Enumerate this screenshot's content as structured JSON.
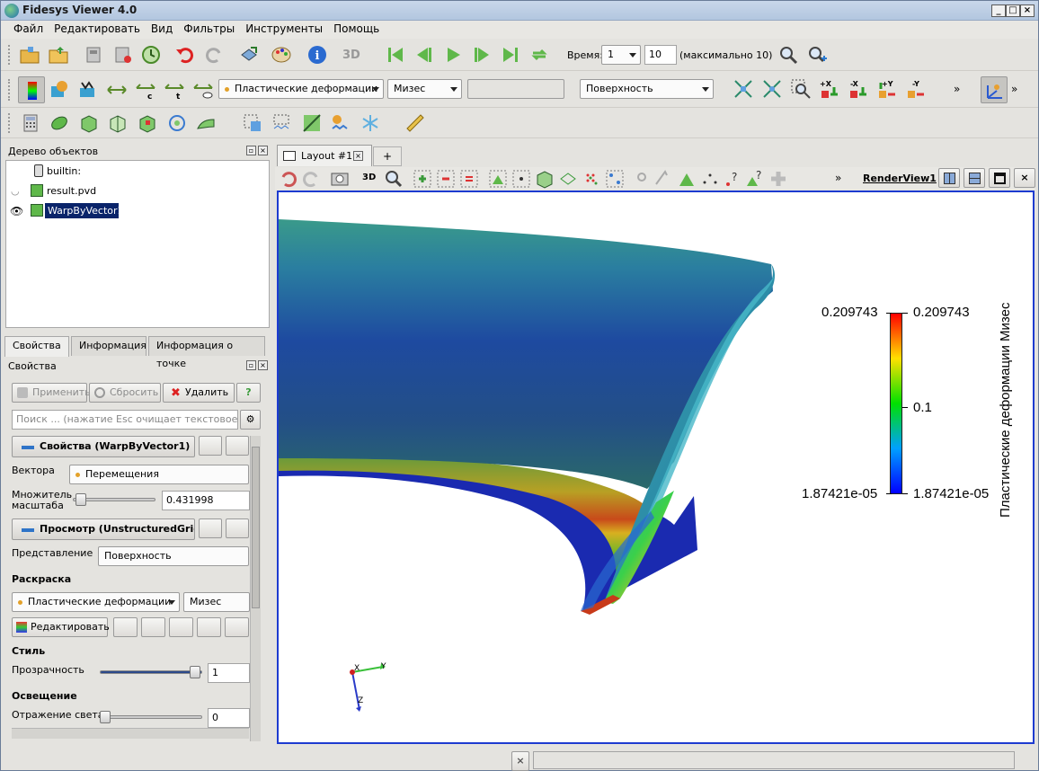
{
  "window": {
    "title": "Fidesys Viewer 4.0"
  },
  "menu": [
    "Файл",
    "Редактировать",
    "Вид",
    "Фильтры",
    "Инструменты",
    "Помощь"
  ],
  "time": {
    "label": "Время:",
    "value": "1",
    "step": "10",
    "max_text": "(максимально 10)"
  },
  "toolbar2": {
    "field": "Пластические деформации",
    "component": "Мизес",
    "representation": "Поверхность"
  },
  "pipeline": {
    "title": "Дерево объектов",
    "items": [
      "builtin:",
      "result.pvd",
      "WarpByVector1"
    ]
  },
  "tabs": {
    "layout": "Layout #1",
    "add": "+",
    "view_name": "RenderView1",
    "props": "Свойства",
    "info": "Информация",
    "point_info": "Информация о точке"
  },
  "props": {
    "title": "Свойства",
    "apply": "Применить",
    "reset": "Сбросить",
    "delete": "Удалить",
    "help": "?",
    "search_placeholder": "Поиск ... (нажатие Esc очищает текстовое по...",
    "section1": "Свойства (WarpByVector1)",
    "vectors_label": "Вектора",
    "vectors_value": "Перемещения",
    "scale_label": "Множитель масштаба",
    "scale_value": "0.431998",
    "scale_level": 0.06,
    "section2": "Просмотр (UnstructuredGrid",
    "repr_label": "Представление",
    "repr_value": "Поверхность",
    "coloring": "Раскраска",
    "color_field": "Пластические деформации",
    "color_comp": "Мизес",
    "edit": "Редактировать",
    "style": "Стиль",
    "opacity_label": "Прозрачность",
    "opacity_value": "1",
    "opacity_level": 1.0,
    "lighting": "Освещение",
    "specular_label": "Отражение света",
    "specular_value": "0",
    "specular_level": 0.0
  },
  "view3d": "3D",
  "legend": {
    "title": "Пластические деформации Мизес",
    "max": "0.209743",
    "mid": "0.1",
    "min": "1.87421e-05"
  },
  "axes": {
    "x": "X",
    "y": "Y",
    "z": "Z"
  },
  "colors": {
    "viewport_border": "#1d3bd0",
    "selection": "#0a246a"
  }
}
